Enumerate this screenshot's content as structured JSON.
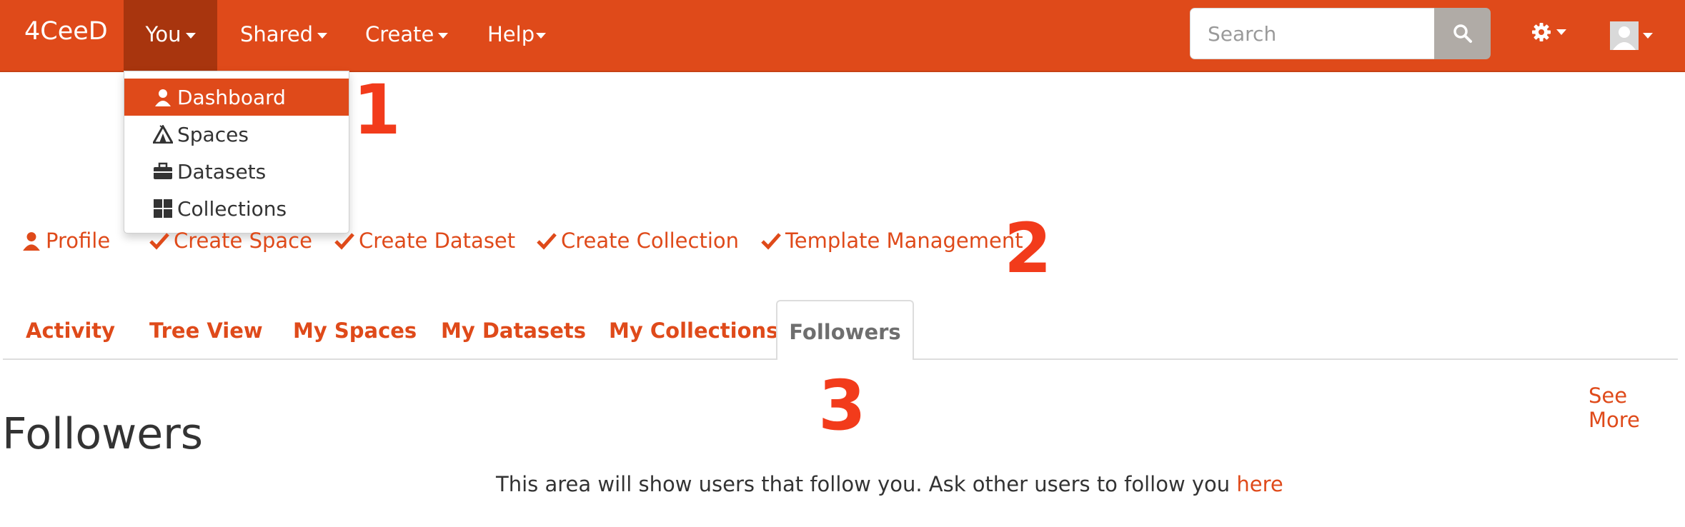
{
  "app": {
    "brand": "4CeeD"
  },
  "nav": {
    "you": "You",
    "shared": "Shared",
    "create": "Create",
    "help": "Help"
  },
  "search": {
    "placeholder": "Search"
  },
  "dropdown": {
    "items": [
      {
        "label": "Dashboard",
        "icon": "user-icon"
      },
      {
        "label": "Spaces",
        "icon": "tent-icon"
      },
      {
        "label": "Datasets",
        "icon": "briefcase-icon"
      },
      {
        "label": "Collections",
        "icon": "grid-icon"
      }
    ]
  },
  "callouts": {
    "one": "1",
    "two": "2",
    "three": "3"
  },
  "actions": {
    "profile": "Profile",
    "create_space": "Create Space",
    "create_dataset": "Create Dataset",
    "create_collection": "Create Collection",
    "template_management": "Template Management"
  },
  "tabs": {
    "activity": "Activity",
    "tree_view": "Tree View",
    "my_spaces": "My Spaces",
    "my_datasets": "My Datasets",
    "my_collections": "My Collections",
    "followers": "Followers"
  },
  "content": {
    "see_more": "See More",
    "title": "Followers",
    "info": "This area will show users that follow you. Ask other users to follow you ",
    "info_link": "here"
  },
  "colors": {
    "accent": "#df4a1a",
    "nav_active": "#a8350e",
    "callout": "#f23b1b"
  }
}
